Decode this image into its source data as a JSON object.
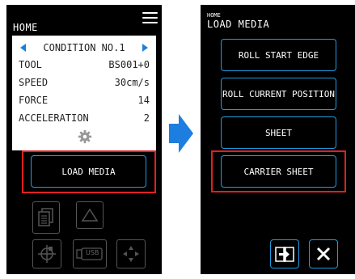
{
  "left": {
    "title": "HOME",
    "condition": {
      "header": "CONDITION NO.1",
      "rows": [
        {
          "label": "TOOL",
          "value": "BS001+0"
        },
        {
          "label": "SPEED",
          "value": "30cm/s"
        },
        {
          "label": "FORCE",
          "value": "14"
        },
        {
          "label": "ACCELERATION",
          "value": "2"
        }
      ]
    },
    "load_media_label": "LOAD MEDIA",
    "usb_label": "USB"
  },
  "right": {
    "breadcrumb": "HOME",
    "title": "LOAD MEDIA",
    "buttons": [
      "ROLL START EDGE",
      "ROLL CURRENT POSITION",
      "SHEET",
      "CARRIER SHEET"
    ]
  },
  "colors": {
    "accent": "#1e9be0",
    "highlight": "#e02020",
    "arrow": "#1e7ee0"
  }
}
